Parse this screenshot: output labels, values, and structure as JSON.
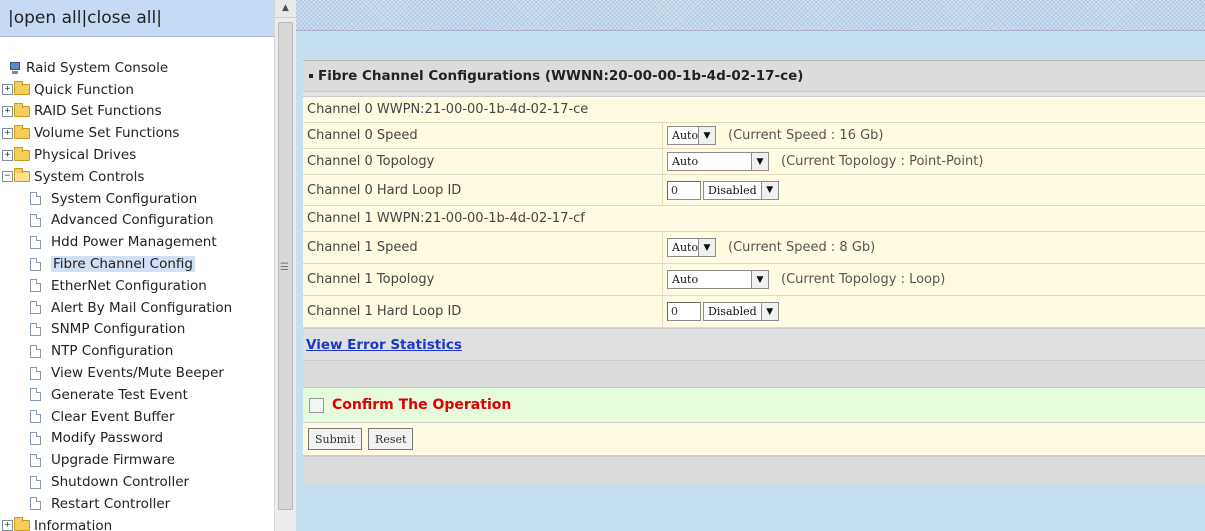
{
  "topbar": {
    "open_all": "open all",
    "close_all": "close all"
  },
  "tree": {
    "root": "Raid System Console",
    "folders": [
      {
        "label": "Quick Function"
      },
      {
        "label": "RAID Set Functions"
      },
      {
        "label": "Volume Set Functions"
      },
      {
        "label": "Physical Drives"
      },
      {
        "label": "System Controls"
      }
    ],
    "system_items": [
      {
        "label": "System Configuration"
      },
      {
        "label": "Advanced Configuration"
      },
      {
        "label": "Hdd Power Management"
      },
      {
        "label": "Fibre Channel Config"
      },
      {
        "label": "EtherNet Configuration"
      },
      {
        "label": "Alert By Mail Configuration"
      },
      {
        "label": "SNMP Configuration"
      },
      {
        "label": "NTP Configuration"
      },
      {
        "label": "View Events/Mute Beeper"
      },
      {
        "label": "Generate Test Event"
      },
      {
        "label": "Clear Event Buffer"
      },
      {
        "label": "Modify Password"
      },
      {
        "label": "Upgrade Firmware"
      },
      {
        "label": "Shutdown Controller"
      },
      {
        "label": "Restart Controller"
      }
    ],
    "information": "Information",
    "selected": "Fibre Channel Config"
  },
  "panel": {
    "title": "Fibre Channel Configurations (WWNN:20-00-00-1b-4d-02-17-ce)",
    "ch0": {
      "wwpn": "Channel 0 WWPN:21-00-00-1b-4d-02-17-ce",
      "speed_label": "Channel 0 Speed",
      "speed_value": "Auto",
      "speed_note": "(Current Speed : 16 Gb)",
      "topo_label": "Channel 0 Topology",
      "topo_value": "Auto",
      "topo_note": "(Current Topology : Point-Point)",
      "loop_label": "Channel 0 Hard Loop ID",
      "loop_input": "0",
      "loop_value": "Disabled"
    },
    "ch1": {
      "wwpn": "Channel 1 WWPN:21-00-00-1b-4d-02-17-cf",
      "speed_label": "Channel 1 Speed",
      "speed_value": "Auto",
      "speed_note": "(Current Speed : 8 Gb)",
      "topo_label": "Channel 1 Topology",
      "topo_value": "Auto",
      "topo_note": "(Current Topology : Loop)",
      "loop_label": "Channel 1 Hard Loop ID",
      "loop_input": "0",
      "loop_value": "Disabled"
    },
    "view_errors": "View Error Statistics",
    "confirm": "Confirm The Operation",
    "submit": "Submit",
    "reset": "Reset"
  },
  "colors": {
    "link": "#1a39c9",
    "confirm_text": "#e00000",
    "confirm_bg": "#e5fbdc",
    "row_bg": "#fffbe2",
    "frame_bg": "#c7e0ef"
  }
}
